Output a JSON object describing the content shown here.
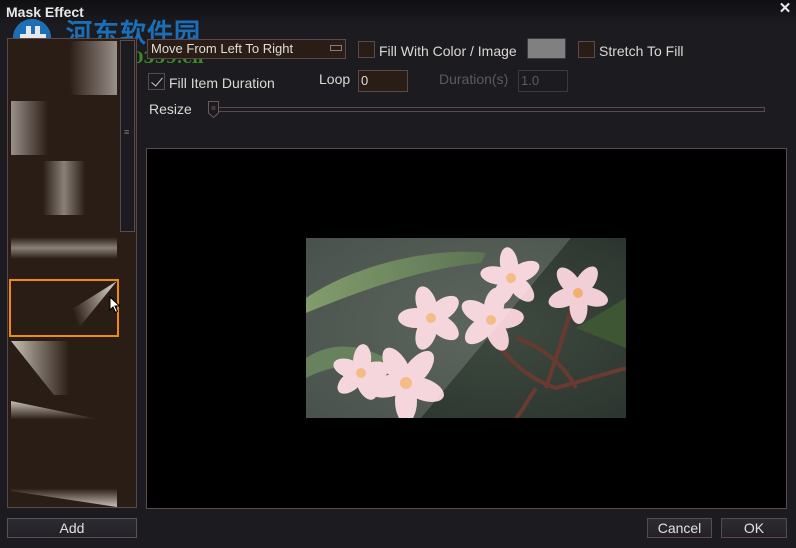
{
  "window": {
    "title": "Mask Effect",
    "close_icon": "close-icon"
  },
  "watermark": {
    "site_name": "河东软件园",
    "url": "www.pc0359.cn"
  },
  "mask_list": {
    "items": [
      {
        "name": "fade-right"
      },
      {
        "name": "fade-left"
      },
      {
        "name": "vertical-bar"
      },
      {
        "name": "horizontal-bar"
      },
      {
        "name": "diagonal-wipe",
        "selected": true
      },
      {
        "name": "diagonal-wedge"
      },
      {
        "name": "trapezoid-frame"
      }
    ],
    "add_label": "Add"
  },
  "controls": {
    "transition": {
      "value": "Move From Left To Right"
    },
    "fill_with_color": {
      "label": "Fill With Color / Image",
      "checked": false,
      "color": "#808080"
    },
    "stretch_to_fill": {
      "label": "Stretch To Fill",
      "checked": false
    },
    "fill_item_duration": {
      "label": "Fill Item Duration",
      "checked": true
    },
    "loop": {
      "label": "Loop",
      "value": "0"
    },
    "duration": {
      "label": "Duration(s)",
      "value": "1.0",
      "disabled": true
    },
    "resize": {
      "label": "Resize",
      "value_fraction": 0.0
    }
  },
  "preview": {
    "content": "plumeria flowers image with diagonal mask"
  },
  "footer": {
    "cancel_label": "Cancel",
    "ok_label": "OK"
  },
  "colors": {
    "accent": "#f08a10",
    "panel": "#2a1d15",
    "background": "#1c1b20",
    "border": "#5a4a4e"
  }
}
